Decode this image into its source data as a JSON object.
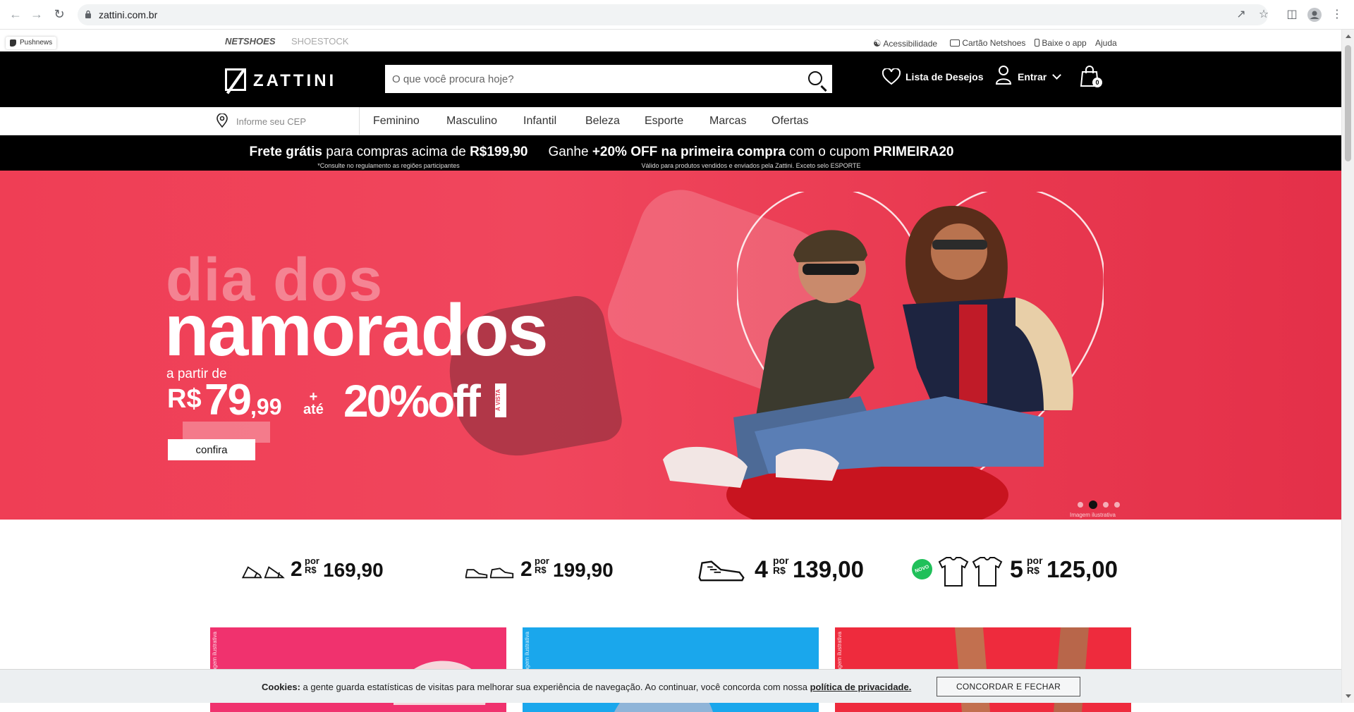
{
  "browser": {
    "url": "zattini.com.br"
  },
  "topbar": {
    "pushnews": "Pushnews",
    "sites": [
      "NETSHOES",
      "SHOESTOCK"
    ],
    "utility": [
      "Acessibilidade",
      "Cartão Netshoes",
      "Baixe o app",
      "Ajuda"
    ]
  },
  "header": {
    "logo": "ZATTINI",
    "search_placeholder": "O que você procura hoje?",
    "wishlist": "Lista de Desejos",
    "login": "Entrar",
    "cart_count": "0"
  },
  "nav": {
    "cep_placeholder": "Informe seu CEP",
    "categories": [
      "Feminino",
      "Masculino",
      "Infantil",
      "Beleza",
      "Esporte",
      "Marcas",
      "Ofertas"
    ]
  },
  "promo": {
    "left_bold": "Frete grátis",
    "left_mid": " para compras acima de ",
    "left_price": "R$199,90",
    "left_sub": "*Consulte no regulamento as regiões participantes",
    "right_pre": "Ganhe ",
    "right_bold": "+20% OFF na primeira compra",
    "right_mid": " com o cupom ",
    "right_code": "PRIMEIRA20",
    "right_sub": "Válido para produtos vendidos e enviados pela Zattini. Exceto selo ESPORTE"
  },
  "hero": {
    "line1": "dia dos",
    "line2": "namorados",
    "from": "a partir de",
    "currency": "R$",
    "price_int": "79",
    "price_dec": ",99",
    "plus_1": "+",
    "plus_2": "até",
    "discount": "20%off",
    "vista": "À VISTA",
    "cta": "confira",
    "illustrative": "Imagem ilustrativa",
    "slide_count": 4,
    "active_slide": 2
  },
  "deals": [
    {
      "qty": "2",
      "por": "por",
      "cur": "R$",
      "price": "169,90"
    },
    {
      "qty": "2",
      "por": "por",
      "cur": "R$",
      "price": "199,90"
    },
    {
      "qty": "4",
      "por": "por",
      "cur": "R$",
      "price": "139,00"
    },
    {
      "qty": "5",
      "por": "por",
      "cur": "R$",
      "price": "125,00",
      "badge": "NOVO"
    }
  ],
  "tiles": [
    {
      "label": "Imagem ilustrativa",
      "color": "#f0326e"
    },
    {
      "label": "Imagem ilustrativa",
      "color": "#1aa7ec"
    },
    {
      "label": "Imagem ilustrativa",
      "color": "#ee2b3d"
    }
  ],
  "cookie": {
    "label": "Cookies:",
    "text": " a gente guarda estatísticas de visitas para melhorar sua experiência de navegação. Ao continuar, você concorda com nossa ",
    "link": "política de privacidade.",
    "button": "CONCORDAR E FECHAR"
  }
}
